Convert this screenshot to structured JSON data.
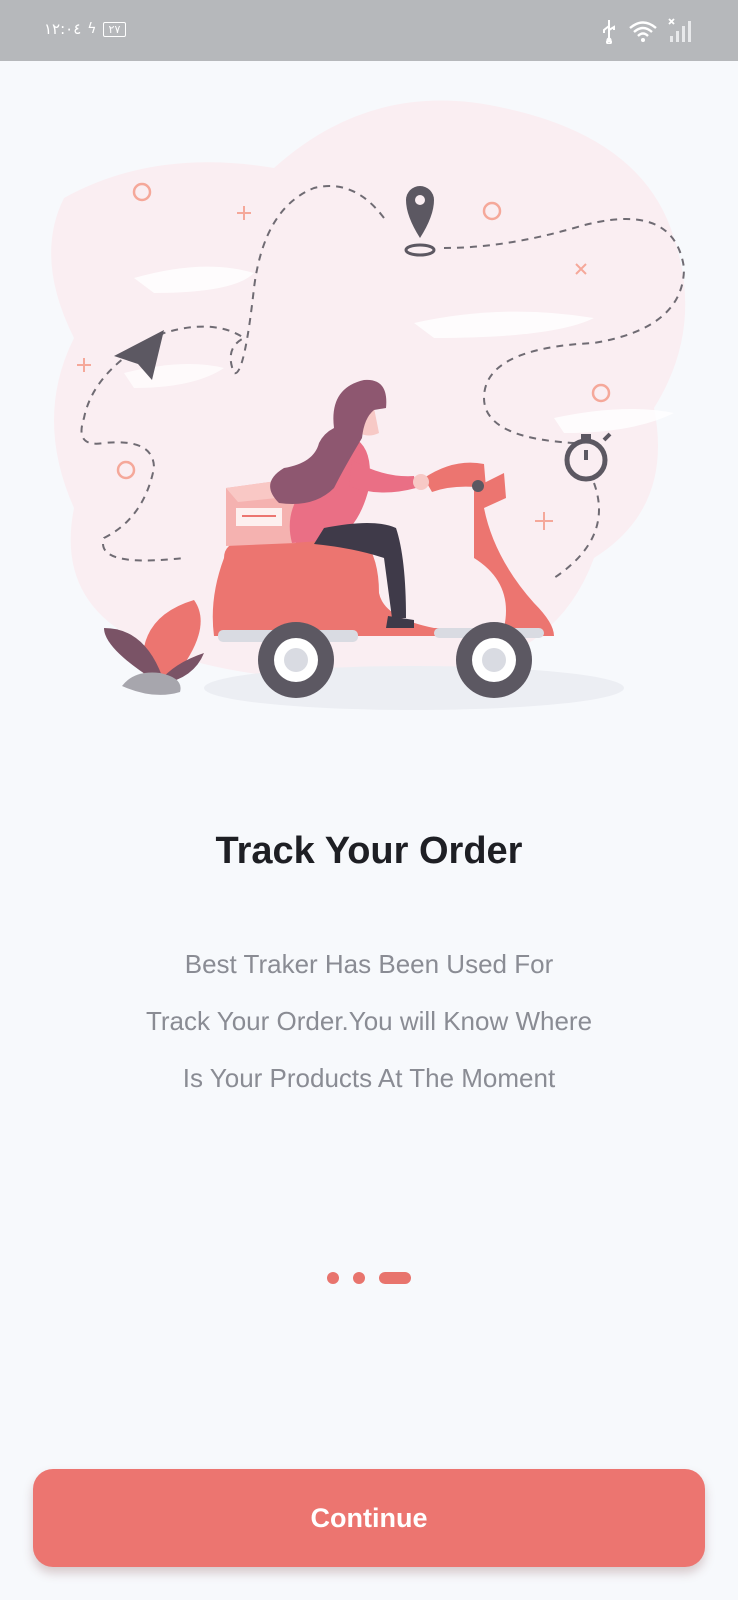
{
  "status_bar": {
    "time": "١٢:٠٤",
    "battery": "٢٧",
    "icons": [
      "usb-icon",
      "wifi-icon",
      "signal-icon"
    ]
  },
  "onboarding": {
    "illustration": "delivery-scooter-illustration",
    "title": "Track Your Order",
    "description_lines": [
      "Best Traker Has Been Used For",
      "Track Your Order.You will Know Where",
      "Is Your Products At The Moment"
    ],
    "page_indicator": {
      "total": 3,
      "current": 3
    },
    "continue_label": "Continue"
  },
  "colors": {
    "accent": "#ec7570",
    "background": "#f7f9fc",
    "title": "#1e1f24",
    "body_text": "#8a8c94",
    "status_bar": "#b6b8bb"
  }
}
